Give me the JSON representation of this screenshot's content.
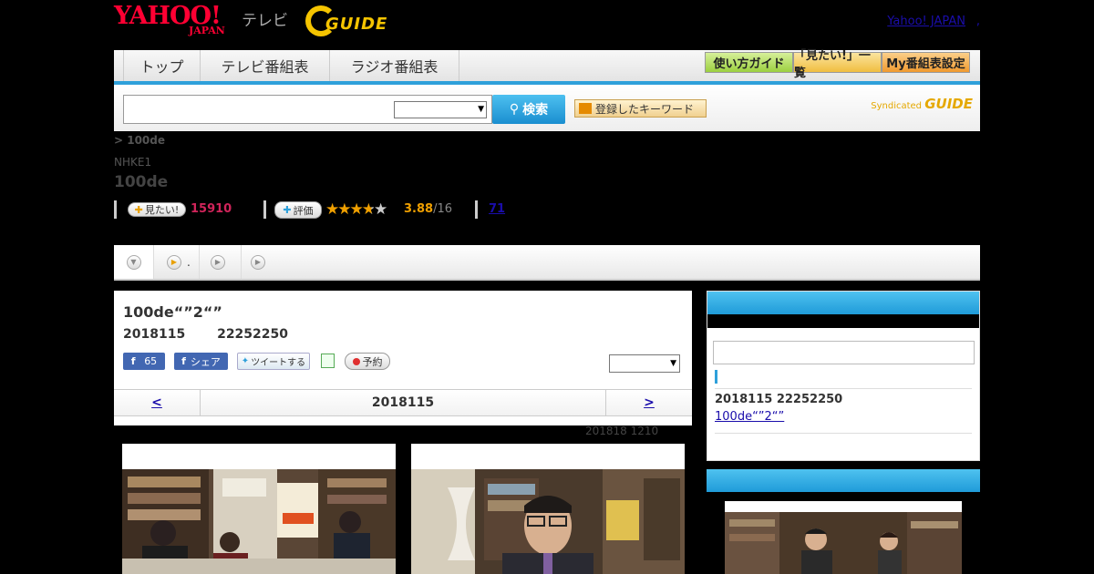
{
  "header": {
    "logo_yahoo": "YAHOO!",
    "logo_japan": "JAPAN",
    "logo_tv": "テレビ",
    "logo_gguide": "GUIDE",
    "yahoo_japan_link": "Yahoo! JAPAN",
    "link_separator": ","
  },
  "nav": {
    "tabs": [
      "トップ",
      "テレビ番組表",
      "ラジオ番組表"
    ],
    "buttons": [
      {
        "label": "使い方ガイド",
        "color": "#a6d84a"
      },
      {
        "label": "「見たい!」一覧",
        "color": "#f5c64a"
      },
      {
        "label": "My番組表設定",
        "color": "#f5a43a"
      }
    ],
    "accent": "#2ea0da"
  },
  "search": {
    "input_value": "",
    "select_value": "",
    "button_label": "検索",
    "keyword_button": "登録したキーワード",
    "syndicated_label": "Syndicated",
    "syndicated_brand": "GUIDE"
  },
  "program": {
    "breadcrumb": "> 100de",
    "channel": "NHKE1",
    "title": "100de",
    "mitai_label": "見たい!",
    "mitai_count": "15910",
    "hyoka_label": "評価",
    "rating": "3.88",
    "rating_of": "/16",
    "rating_stars": 3.88,
    "reviews": "71"
  },
  "tabs": [
    {
      "label": "",
      "icon": "chevron-down-icon"
    },
    {
      "label": ".",
      "icon": "play-icon"
    },
    {
      "label": "",
      "icon": "play-icon"
    },
    {
      "label": "",
      "icon": "play-icon"
    }
  ],
  "episode": {
    "title": "100de“”2“”",
    "date": "2018115",
    "time": "22252250",
    "fb_like_count": "65",
    "fb_share": "シェア",
    "tweet": "ツイートする",
    "reserve": "予約",
    "select_value": "",
    "pager_prev": "<",
    "pager_date": "2018115",
    "pager_next": ">",
    "updated": "201818  1210"
  },
  "sidebar": {
    "time": "2018115  22252250",
    "link": "100de“”2“”"
  }
}
